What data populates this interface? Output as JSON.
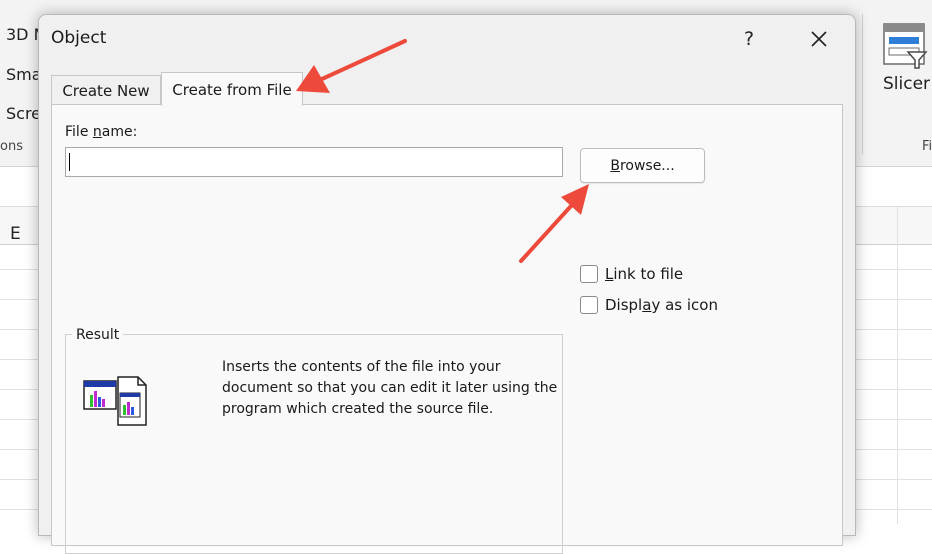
{
  "ribbon": {
    "items": [
      "3D M",
      "Sma",
      "Scre"
    ],
    "group_left": "ons",
    "group_right": "Fi",
    "slicer_label": "Slicer"
  },
  "sheet": {
    "column_letter": "E"
  },
  "dialog": {
    "title": "Object",
    "help_label": "?",
    "tabs": [
      "Create New",
      "Create from File"
    ],
    "file_name_label_pre": "File ",
    "file_name_label_accel": "n",
    "file_name_label_post": "ame:",
    "file_name_value": "",
    "browse_label_pre": "",
    "browse_label_accel": "B",
    "browse_label_post": "rowse...",
    "link_label_pre": "",
    "link_label_accel": "L",
    "link_label_post": "ink to file",
    "link_checked": false,
    "icon_label_pre": "Displ",
    "icon_label_accel": "a",
    "icon_label_post": "y as icon",
    "icon_checked": false,
    "result_legend": "Result",
    "result_text": "Inserts the contents of the file into your document so that you can edit it later using the program which created the source file."
  },
  "colors": {
    "arrow": "#ee4a3b",
    "dialog_bg": "#f0f0f0",
    "panel_bg": "#f9f9f9"
  }
}
